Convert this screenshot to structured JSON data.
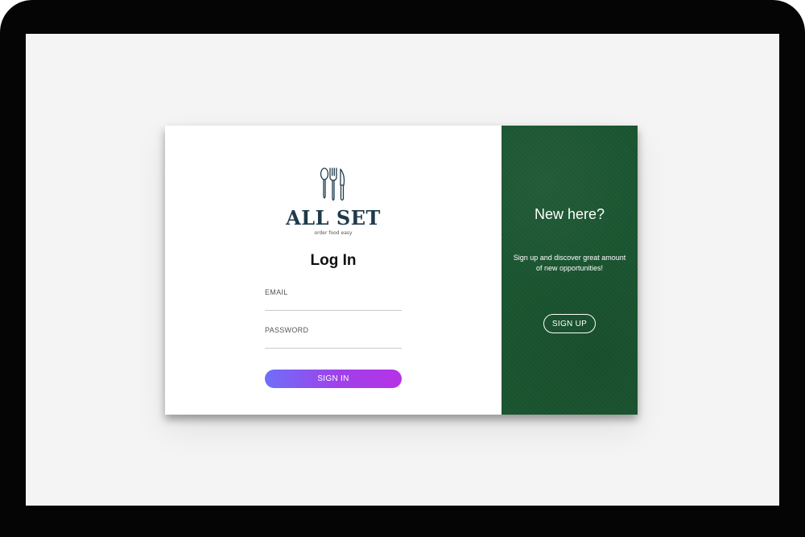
{
  "brand": {
    "name": "ALL SET",
    "tagline": "order food easy",
    "logo_icon": "cutlery-icon"
  },
  "login": {
    "title": "Log In",
    "email_label": "EMAIL",
    "email_value": "",
    "password_label": "PASSWORD",
    "password_value": "",
    "signin_label": "SIGN IN"
  },
  "signup": {
    "title": "New here?",
    "description": "Sign up and discover great amount of new opportunities!",
    "button_label": "SIGN UP"
  },
  "colors": {
    "brand_text": "#1e3a4c",
    "signup_panel": "#1a5530",
    "signin_gradient_start": "#6f6ff8",
    "signin_gradient_end": "#b533e6"
  }
}
